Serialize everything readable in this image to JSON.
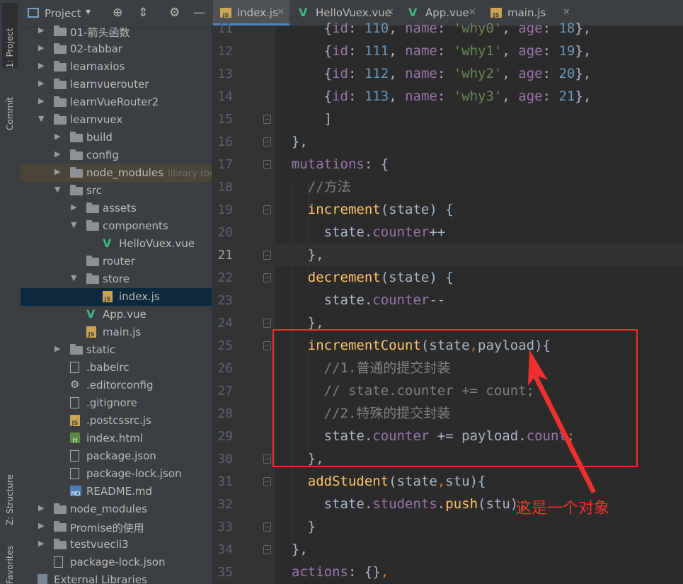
{
  "left_strip": {
    "project_tab": "1: Project",
    "commit_tab": "Commit",
    "structure_tab": "Z: Structure",
    "favorites_tab": "Favorites"
  },
  "project_panel": {
    "title": "Project",
    "tree": [
      {
        "label": "01-箭头函数",
        "type": "folder",
        "level": 1,
        "expanded": false
      },
      {
        "label": "02-tabbar",
        "type": "folder",
        "level": 1,
        "expanded": false
      },
      {
        "label": "learnaxios",
        "type": "folder",
        "level": 1,
        "expanded": false
      },
      {
        "label": "learnvuerouter",
        "type": "folder",
        "level": 1,
        "expanded": false
      },
      {
        "label": "learnVueRouter2",
        "type": "folder",
        "level": 1,
        "expanded": false
      },
      {
        "label": "learnvuex",
        "type": "folder",
        "level": 1,
        "expanded": true
      },
      {
        "label": "build",
        "type": "folder",
        "level": 2,
        "expanded": false
      },
      {
        "label": "config",
        "type": "folder",
        "level": 2,
        "expanded": false
      },
      {
        "label": "node_modules",
        "type": "folder",
        "level": 2,
        "expanded": false,
        "extra": "library roo"
      },
      {
        "label": "src",
        "type": "folder",
        "level": 2,
        "expanded": true
      },
      {
        "label": "assets",
        "type": "folder",
        "level": 3,
        "expanded": false
      },
      {
        "label": "components",
        "type": "folder",
        "level": 3,
        "expanded": true
      },
      {
        "label": "HelloVuex.vue",
        "type": "vue",
        "level": 4
      },
      {
        "label": "router",
        "type": "folder",
        "level": 3,
        "expanded": null
      },
      {
        "label": "store",
        "type": "folder",
        "level": 3,
        "expanded": true
      },
      {
        "label": "index.js",
        "type": "js",
        "level": 4,
        "selected": true
      },
      {
        "label": "App.vue",
        "type": "vue",
        "level": 3
      },
      {
        "label": "main.js",
        "type": "js",
        "level": 3
      },
      {
        "label": "static",
        "type": "folder",
        "level": 2,
        "expanded": false
      },
      {
        "label": ".babelrc",
        "type": "file",
        "level": 2
      },
      {
        "label": ".editorconfig",
        "type": "gear",
        "level": 2
      },
      {
        "label": ".gitignore",
        "type": "file",
        "level": 2
      },
      {
        "label": ".postcssrc.js",
        "type": "js",
        "level": 2
      },
      {
        "label": "index.html",
        "type": "html",
        "level": 2
      },
      {
        "label": "package.json",
        "type": "json",
        "level": 2
      },
      {
        "label": "package-lock.json",
        "type": "json",
        "level": 2
      },
      {
        "label": "README.md",
        "type": "md",
        "level": 2
      },
      {
        "label": "node_modules",
        "type": "folder",
        "level": 1,
        "expanded": false
      },
      {
        "label": "Promise的使用",
        "type": "folder",
        "level": 1,
        "expanded": false
      },
      {
        "label": "testvuecli3",
        "type": "folder",
        "level": 1,
        "expanded": false
      },
      {
        "label": "package-lock.json",
        "type": "json",
        "level": 1
      },
      {
        "label": "External Libraries",
        "type": "lib",
        "level": 0
      }
    ]
  },
  "editor_tabs": [
    {
      "label": "index.js",
      "icon": "js",
      "active": true
    },
    {
      "label": "HelloVuex.vue",
      "icon": "vue",
      "active": false
    },
    {
      "label": "App.vue",
      "icon": "vue",
      "active": false
    },
    {
      "label": "main.js",
      "icon": "js",
      "active": false
    }
  ],
  "code": {
    "current_line": 21,
    "lines": [
      {
        "n": "11",
        "tokens": [
          [
            "p",
            "      {"
          ],
          [
            "prop",
            "id"
          ],
          [
            "p",
            ": "
          ],
          [
            "num",
            "110"
          ],
          [
            "p",
            ", "
          ],
          [
            "prop",
            "name"
          ],
          [
            "p",
            ": "
          ],
          [
            "str",
            "'why0'"
          ],
          [
            "p",
            ", "
          ],
          [
            "prop",
            "age"
          ],
          [
            "p",
            ": "
          ],
          [
            "num",
            "18"
          ],
          [
            "p",
            "},"
          ]
        ]
      },
      {
        "n": "12",
        "tokens": [
          [
            "p",
            "      {"
          ],
          [
            "prop",
            "id"
          ],
          [
            "p",
            ": "
          ],
          [
            "num",
            "111"
          ],
          [
            "p",
            ", "
          ],
          [
            "prop",
            "name"
          ],
          [
            "p",
            ": "
          ],
          [
            "str",
            "'why1'"
          ],
          [
            "p",
            ", "
          ],
          [
            "prop",
            "age"
          ],
          [
            "p",
            ": "
          ],
          [
            "num",
            "19"
          ],
          [
            "p",
            "},"
          ]
        ]
      },
      {
        "n": "13",
        "tokens": [
          [
            "p",
            "      {"
          ],
          [
            "prop",
            "id"
          ],
          [
            "p",
            ": "
          ],
          [
            "num",
            "112"
          ],
          [
            "p",
            ", "
          ],
          [
            "prop",
            "name"
          ],
          [
            "p",
            ": "
          ],
          [
            "str",
            "'why2'"
          ],
          [
            "p",
            ", "
          ],
          [
            "prop",
            "age"
          ],
          [
            "p",
            ": "
          ],
          [
            "num",
            "20"
          ],
          [
            "p",
            "},"
          ]
        ]
      },
      {
        "n": "14",
        "tokens": [
          [
            "p",
            "      {"
          ],
          [
            "prop",
            "id"
          ],
          [
            "p",
            ": "
          ],
          [
            "num",
            "113"
          ],
          [
            "p",
            ", "
          ],
          [
            "prop",
            "name"
          ],
          [
            "p",
            ": "
          ],
          [
            "str",
            "'why3'"
          ],
          [
            "p",
            ", "
          ],
          [
            "prop",
            "age"
          ],
          [
            "p",
            ": "
          ],
          [
            "num",
            "21"
          ],
          [
            "p",
            "},"
          ]
        ]
      },
      {
        "n": "15",
        "tokens": [
          [
            "p",
            "      ]"
          ]
        ]
      },
      {
        "n": "16",
        "tokens": [
          [
            "p",
            "  },"
          ]
        ]
      },
      {
        "n": "17",
        "tokens": [
          [
            "prop",
            "  mutations"
          ],
          [
            "p",
            ": {"
          ]
        ]
      },
      {
        "n": "18",
        "tokens": [
          [
            "cmt",
            "    //方法"
          ]
        ]
      },
      {
        "n": "19",
        "tokens": [
          [
            "fn",
            "    increment"
          ],
          [
            "p",
            "(state) {"
          ]
        ]
      },
      {
        "n": "20",
        "tokens": [
          [
            "p",
            "      state."
          ],
          [
            "prop",
            "counter"
          ],
          [
            "p",
            "++"
          ]
        ]
      },
      {
        "n": "21",
        "tokens": [
          [
            "p",
            "    },"
          ]
        ]
      },
      {
        "n": "22",
        "tokens": [
          [
            "fn",
            "    decrement"
          ],
          [
            "p",
            "(state) {"
          ]
        ]
      },
      {
        "n": "23",
        "tokens": [
          [
            "p",
            "      state."
          ],
          [
            "prop",
            "counter"
          ],
          [
            "p",
            "--"
          ]
        ]
      },
      {
        "n": "24",
        "tokens": [
          [
            "p",
            "    },"
          ]
        ]
      },
      {
        "n": "25",
        "tokens": [
          [
            "fn",
            "    incrementCount"
          ],
          [
            "p",
            "(state"
          ],
          [
            "kw",
            ","
          ],
          [
            "p",
            "payload){"
          ]
        ]
      },
      {
        "n": "26",
        "tokens": [
          [
            "cmt",
            "      //1.普通的提交封装"
          ]
        ]
      },
      {
        "n": "27",
        "tokens": [
          [
            "cmt",
            "      // state.counter += count;"
          ]
        ]
      },
      {
        "n": "28",
        "tokens": [
          [
            "cmt",
            "      //2.特殊的提交封装"
          ]
        ]
      },
      {
        "n": "29",
        "tokens": [
          [
            "p",
            "      state."
          ],
          [
            "prop",
            "counter"
          ],
          [
            "p",
            " += payload."
          ],
          [
            "prop",
            "count"
          ],
          [
            "kw",
            ";"
          ]
        ]
      },
      {
        "n": "30",
        "tokens": [
          [
            "p",
            "    },"
          ]
        ]
      },
      {
        "n": "31",
        "tokens": [
          [
            "fn",
            "    addStudent"
          ],
          [
            "p",
            "(state"
          ],
          [
            "kw",
            ","
          ],
          [
            "p",
            "stu){"
          ]
        ]
      },
      {
        "n": "32",
        "tokens": [
          [
            "p",
            "      state."
          ],
          [
            "prop",
            "students"
          ],
          [
            "p",
            "."
          ],
          [
            "fn",
            "push"
          ],
          [
            "p",
            "(stu)"
          ],
          [
            "kw",
            ";"
          ]
        ]
      },
      {
        "n": "33",
        "tokens": [
          [
            "p",
            "    }"
          ]
        ]
      },
      {
        "n": "34",
        "tokens": [
          [
            "p",
            "  },"
          ]
        ]
      },
      {
        "n": "35",
        "tokens": [
          [
            "prop",
            "  actions"
          ],
          [
            "p",
            ": {}"
          ],
          [
            "kw",
            ","
          ]
        ]
      },
      {
        "n": "36",
        "tokens": [
          [
            "p",
            "  "
          ]
        ]
      }
    ]
  },
  "annotation": {
    "text": "这是一个对象",
    "color": "#f0302e"
  },
  "colors": {
    "keyword": "#cc7832",
    "property": "#9876aa",
    "function": "#ffc66d",
    "number": "#6897bb",
    "string": "#6a8759",
    "comment": "#808080",
    "selection": "#0d293e"
  }
}
